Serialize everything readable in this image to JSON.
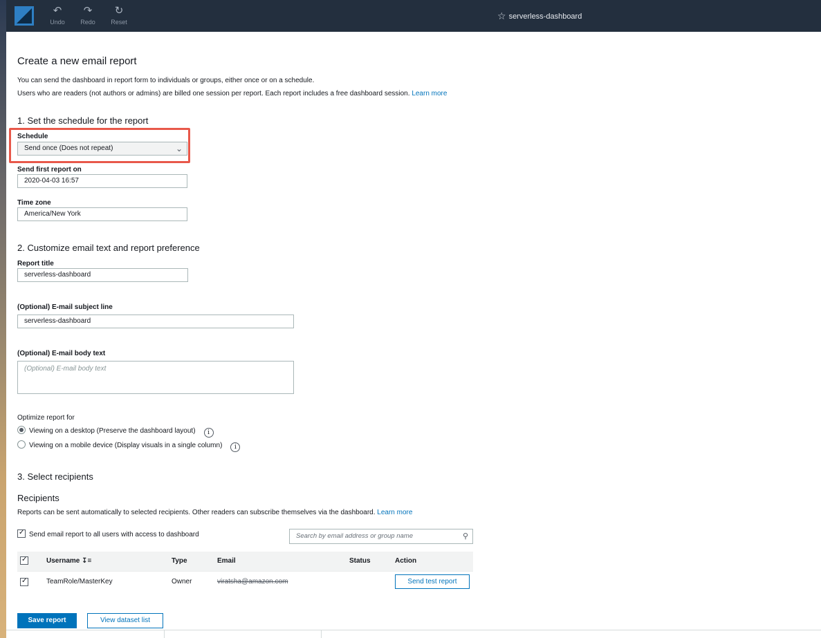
{
  "toolbar": {
    "undo_label": "Undo",
    "redo_label": "Redo",
    "reset_label": "Reset",
    "dashboard_name": "serverless-dashboard"
  },
  "page": {
    "title": "Create a new email report",
    "intro_line1": "You can send the dashboard in report form to individuals or groups, either once or on a schedule.",
    "intro_line2": "Users who are readers (not authors or admins) are billed one session per report. Each report includes a free dashboard session.",
    "learn_more": "Learn more"
  },
  "schedule_section": {
    "heading": "1. Set the schedule for the report",
    "schedule_label": "Schedule",
    "schedule_value": "Send once (Does not repeat)",
    "first_report_label": "Send first report on",
    "first_report_value": "2020-04-03 16:57",
    "timezone_label": "Time zone",
    "timezone_value": "America/New York"
  },
  "customize_section": {
    "heading": "2. Customize email text and report preference",
    "report_title_label": "Report title",
    "report_title_value": "serverless-dashboard",
    "subject_label": "(Optional) E-mail subject line",
    "subject_value": "serverless-dashboard",
    "body_label": "(Optional) E-mail body text",
    "body_placeholder": "(Optional) E-mail body text",
    "optimize_label": "Optimize report for",
    "option_desktop": "Viewing on a desktop (Preserve the dashboard layout)",
    "option_mobile": "Viewing on a mobile device (Display visuals in a single column)",
    "info_glyph": "i"
  },
  "recipients_section": {
    "heading": "3. Select recipients",
    "subheading": "Recipients",
    "description": "Reports can be sent automatically to selected recipients. Other readers can subscribe themselves via the dashboard.",
    "learn_more": "Learn more",
    "send_all_label": "Send email report to all users with access to dashboard",
    "search_placeholder": "Search by email address or group name",
    "columns": {
      "username": "Username",
      "type": "Type",
      "email": "Email",
      "status": "Status",
      "action": "Action"
    },
    "rows": [
      {
        "username": "TeamRole/MasterKey",
        "type": "Owner",
        "email": "viratsha@amazon.com",
        "status": "",
        "action": "Send test report"
      }
    ]
  },
  "footer": {
    "save_label": "Save report",
    "view_dataset_label": "View dataset list"
  }
}
